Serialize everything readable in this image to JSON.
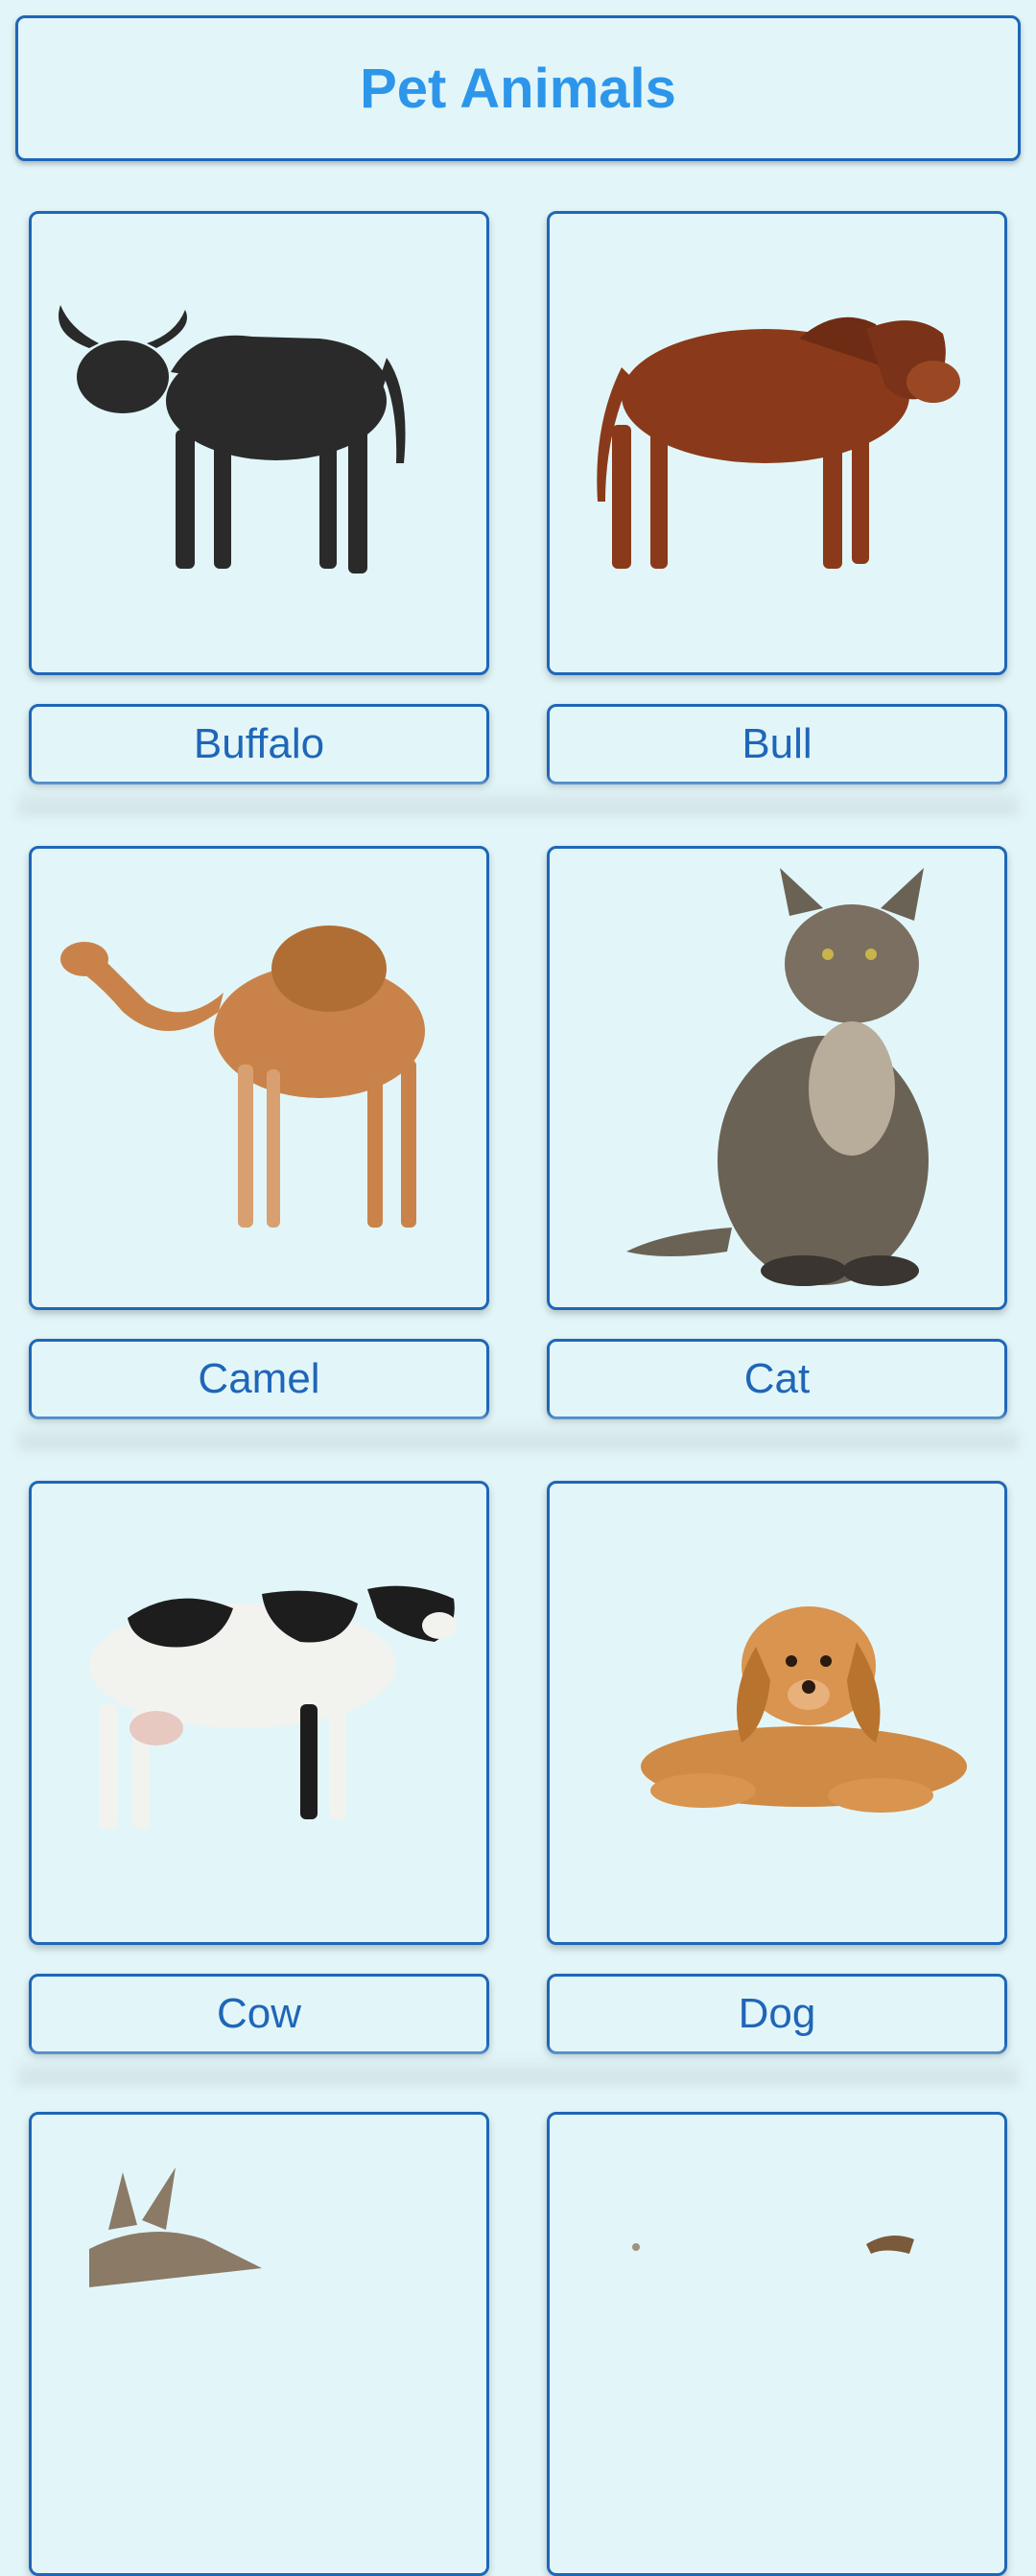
{
  "header": {
    "title": "Pet Animals"
  },
  "animals": [
    {
      "label": "Buffalo",
      "icon": "buffalo-icon",
      "color": "#2b2b2b"
    },
    {
      "label": "Bull",
      "icon": "bull-icon",
      "color": "#8a3a1a"
    },
    {
      "label": "Camel",
      "icon": "camel-icon",
      "color": "#c9834a"
    },
    {
      "label": "Cat",
      "icon": "cat-icon",
      "color": "#6b6256"
    },
    {
      "label": "Cow",
      "icon": "cow-icon",
      "color": "#1d1d1d"
    },
    {
      "label": "Dog",
      "icon": "dog-icon",
      "color": "#cf8a45"
    },
    {
      "label": "",
      "icon": "donkey-icon",
      "color": "#8a7a66"
    },
    {
      "label": "",
      "icon": "goat-icon",
      "color": "#7a5a3a"
    }
  ],
  "colors": {
    "background": "#e2f6f9",
    "border": "#1f66b8",
    "title": "#2d96ea"
  }
}
